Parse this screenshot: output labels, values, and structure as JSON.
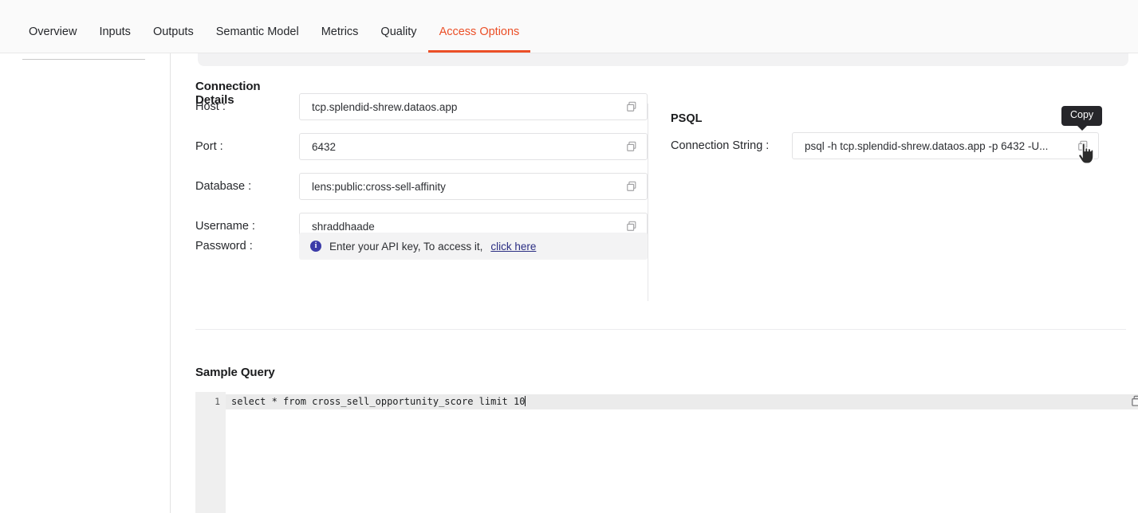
{
  "nav": {
    "tabs": [
      {
        "label": "Overview",
        "active": false
      },
      {
        "label": "Inputs",
        "active": false
      },
      {
        "label": "Outputs",
        "active": false
      },
      {
        "label": "Semantic Model",
        "active": false
      },
      {
        "label": "Metrics",
        "active": false
      },
      {
        "label": "Quality",
        "active": false
      },
      {
        "label": "Access Options",
        "active": true
      }
    ],
    "active_color": "#eb4f27",
    "inactive_color": "#26282c"
  },
  "connection_details": {
    "title": "Connection Details",
    "fields": [
      {
        "label": "Host :",
        "value": "tcp.splendid-shrew.dataos.app",
        "copy_icon": "copy-icon"
      },
      {
        "label": "Port :",
        "value": "6432",
        "copy_icon": "copy-icon"
      },
      {
        "label": "Database :",
        "value": "lens:public:cross-sell-affinity",
        "copy_icon": "copy-icon"
      },
      {
        "label": "Username :",
        "value": "shraddhaade",
        "copy_icon": "copy-icon"
      }
    ],
    "password": {
      "label": "Password :",
      "icon": "info-icon",
      "icon_color": "#3b3ba8",
      "text": "Enter your API key, To access it,",
      "link_label": "click here",
      "link_color": "#2b2e83"
    }
  },
  "psql": {
    "title": "PSQL",
    "connection_string_label": "Connection String :",
    "connection_string_value": "psql -h tcp.splendid-shrew.dataos.app -p 6432 -U...",
    "copy_icon": "copy-icon",
    "tooltip": "Copy",
    "tooltip_bg": "#26262a"
  },
  "sample_query": {
    "title": "Sample Query",
    "line_number": "1",
    "code": "select * from cross_sell_opportunity_score limit 10",
    "copy_icon": "copy-icon",
    "gutter_bg": "#efefef",
    "active_line_bg": "#ebebeb"
  }
}
